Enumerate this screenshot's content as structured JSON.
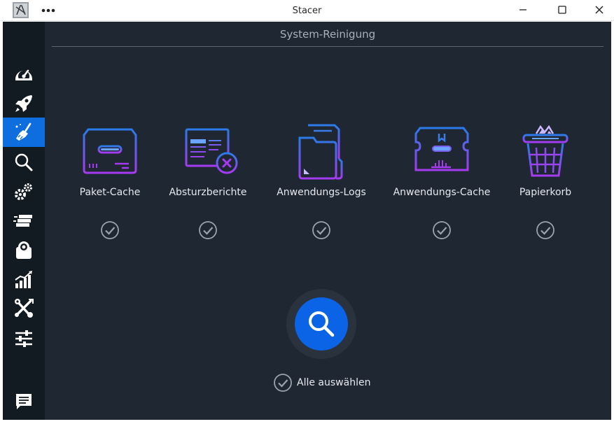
{
  "window": {
    "title": "Stacer",
    "app_icon": "stacer-logo-icon",
    "menu_icon": "more-dots-icon",
    "controls": [
      "minimize-icon",
      "maximize-icon",
      "close-icon"
    ]
  },
  "sidebar": {
    "items": [
      {
        "icon": "dashboard-gauge-icon",
        "active": false
      },
      {
        "icon": "rocket-startup-icon",
        "active": false
      },
      {
        "icon": "broom-cleaner-icon",
        "active": true
      },
      {
        "icon": "search-icon",
        "active": false
      },
      {
        "icon": "gears-services-icon",
        "active": false
      },
      {
        "icon": "processes-stack-icon",
        "active": false
      },
      {
        "icon": "uninstaller-package-icon",
        "active": false
      },
      {
        "icon": "resources-chart-icon",
        "active": false
      },
      {
        "icon": "tools-icon",
        "active": false
      },
      {
        "icon": "settings-sliders-icon",
        "active": false
      }
    ],
    "feedback_icon": "feedback-message-icon",
    "active_color": "#0e6ee0"
  },
  "main": {
    "title": "System-Reinigung",
    "categories": [
      {
        "label": "Paket-Cache",
        "icon": "package-cache-icon",
        "checked": true
      },
      {
        "label": "Absturzberichte",
        "icon": "crash-reports-icon",
        "checked": true
      },
      {
        "label": "Anwendungs-Logs",
        "icon": "app-logs-folder-icon",
        "checked": true
      },
      {
        "label": "Anwendungs-Cache",
        "icon": "app-cache-box-icon",
        "checked": true
      },
      {
        "label": "Papierkorb",
        "icon": "trash-basket-icon",
        "checked": true
      }
    ],
    "scan_button_icon": "search-icon",
    "select_all_label": "Alle auswählen",
    "select_all_checked": true
  },
  "colors": {
    "background": "#1f2733",
    "sidebar": "#121a22",
    "accent": "#0b63e5",
    "icon_gradient_start": "#2b7be8",
    "icon_gradient_end": "#a53bf0"
  }
}
